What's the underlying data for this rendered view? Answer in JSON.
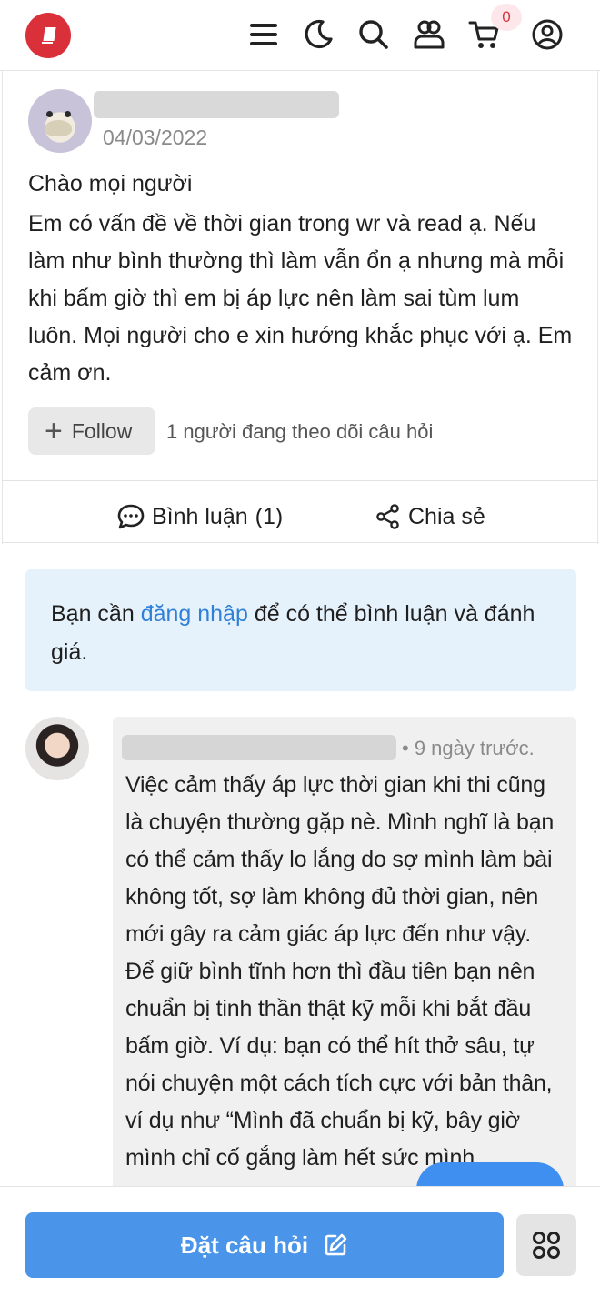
{
  "header": {
    "logo": "book-logo",
    "icons": [
      "menu-icon",
      "moon-icon",
      "search-icon",
      "community-icon",
      "cart-icon",
      "user-icon"
    ],
    "cart_count": "0",
    "accent_color": "#d9303a"
  },
  "question": {
    "date": "04/03/2022",
    "title": "Chào mọi người",
    "body": "Em có vấn đề về thời gian trong wr và read ạ. Nếu làm như bình thường thì làm vẫn ổn ạ nhưng mà mỗi khi bấm giờ thì em bị áp lực nên làm sai tùm lum luôn. Mọi người cho e xin hướng khắc phục với ạ. Em cảm ơn.",
    "follow_label": "Follow",
    "follow_count_text": "1 người đang theo dõi câu hỏi",
    "comment_label": "Bình luận",
    "comment_count": "(1)",
    "share_label": "Chia sẻ"
  },
  "notice": {
    "prefix": "Bạn cần ",
    "link": "đăng nhập",
    "suffix": " để có thể bình luận và đánh giá."
  },
  "comment": {
    "time": "• 9 ngày trước.",
    "text": "Việc cảm thấy áp lực thời gian khi thi cũng là chuyện thường gặp nè. Mình nghĩ là bạn có thể cảm thấy lo lắng do sợ mình làm bài không tốt, sợ làm không đủ thời gian, nên mới gây ra cảm giác áp lực đến như vậy. Để giữ bình tĩnh hơn thì đầu tiên bạn nên chuẩn bị tinh thần thật kỹ mỗi khi bắt đầu bấm giờ. Ví dụ: bạn có thể hít thở sâu, tự nói chuyện một cách tích cực với bản thân, ví dụ như “Mình đã chuẩn bị kỹ, bây giờ mình chỉ cố gắng làm hết sức mình"
  },
  "bottom": {
    "ask_label": "Đặt câu hỏi",
    "primary_color": "#4a95ea"
  }
}
